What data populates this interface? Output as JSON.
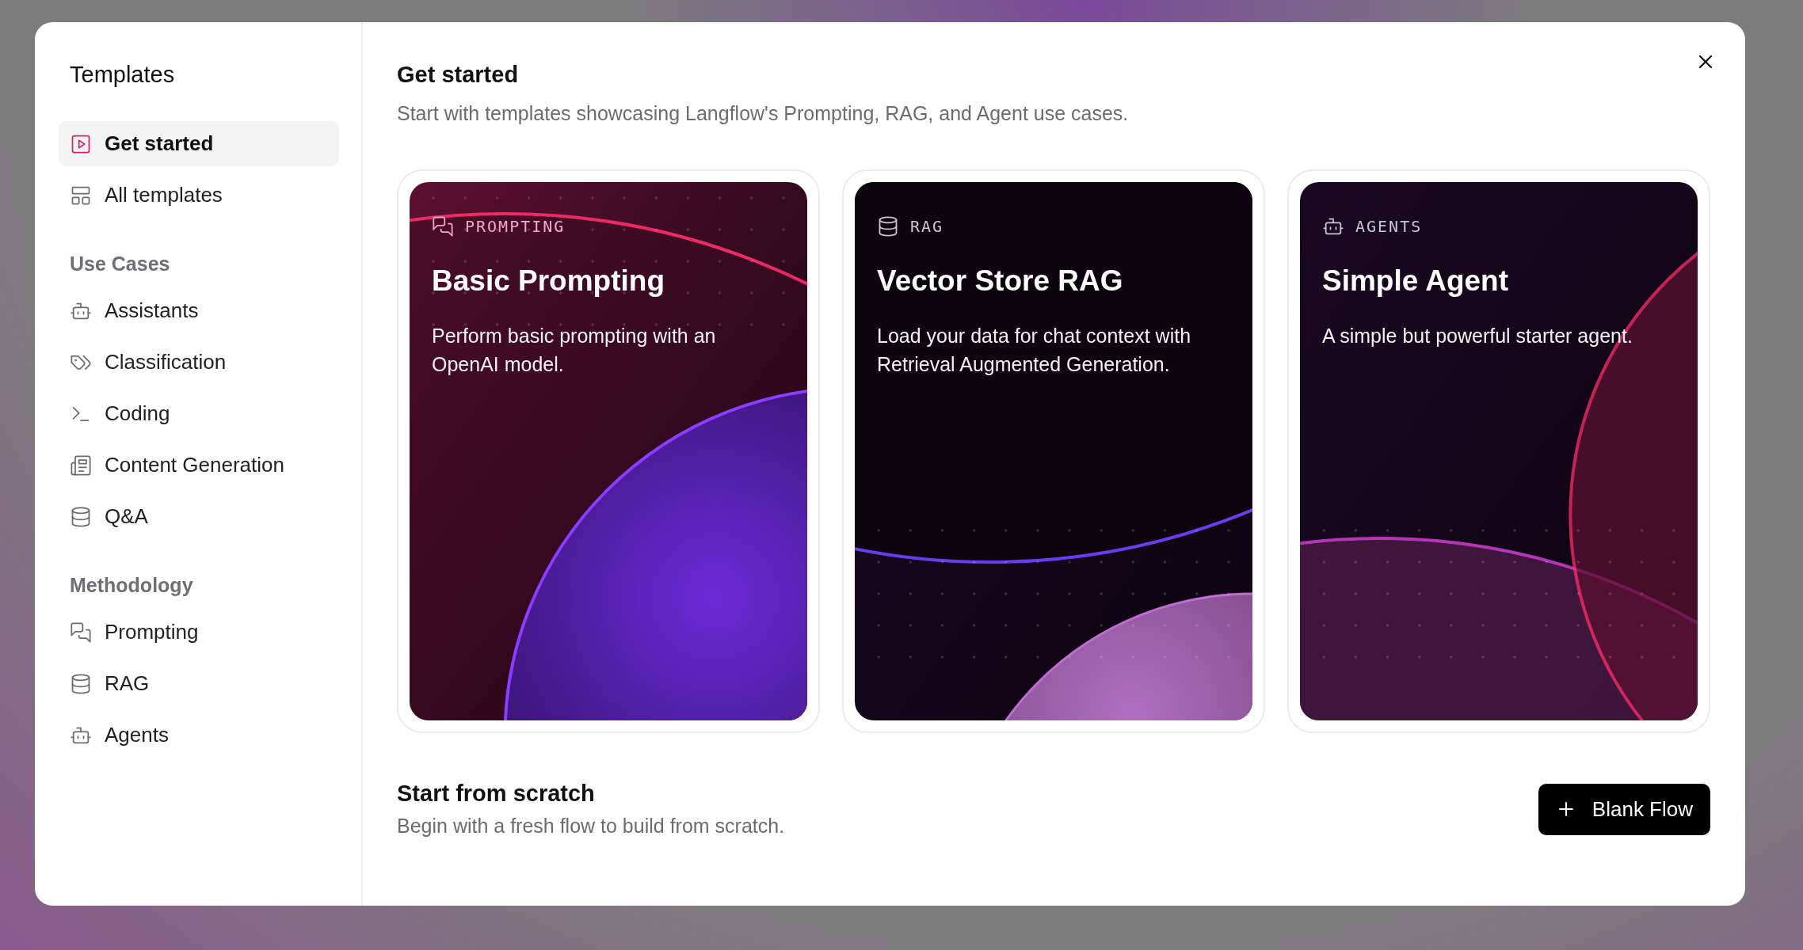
{
  "sidebar": {
    "title": "Templates",
    "items": [
      {
        "label": "Get started",
        "kind": "play",
        "selected": true
      },
      {
        "label": "All templates",
        "kind": "layout",
        "selected": false
      }
    ],
    "sections": [
      {
        "heading": "Use Cases",
        "items": [
          {
            "label": "Assistants",
            "kind": "bot",
            "selected": false
          },
          {
            "label": "Classification",
            "kind": "tags",
            "selected": false
          },
          {
            "label": "Coding",
            "kind": "terminal",
            "selected": false
          },
          {
            "label": "Content Generation",
            "kind": "newspaper",
            "selected": false
          },
          {
            "label": "Q&A",
            "kind": "database",
            "selected": false
          }
        ]
      },
      {
        "heading": "Methodology",
        "items": [
          {
            "label": "Prompting",
            "kind": "messages",
            "selected": false
          },
          {
            "label": "RAG",
            "kind": "database",
            "selected": false
          },
          {
            "label": "Agents",
            "kind": "bot",
            "selected": false
          }
        ]
      }
    ]
  },
  "main": {
    "title": "Get started",
    "subtitle": "Start with templates showcasing Langflow's Prompting, RAG, and Agent use cases.",
    "cards": [
      {
        "kind": "prompting",
        "tag": "PROMPTING",
        "title": "Basic Prompting",
        "description": "Perform basic prompting with an OpenAI model."
      },
      {
        "kind": "rag",
        "tag": "RAG",
        "title": "Vector Store RAG",
        "description": "Load your data for chat context with Retrieval Augmented Generation."
      },
      {
        "kind": "agents",
        "tag": "AGENTS",
        "title": "Simple Agent",
        "description": "A simple but powerful starter agent."
      }
    ],
    "scratch": {
      "title": "Start from scratch",
      "subtitle": "Begin with a fresh flow to build from scratch.",
      "button": "Blank Flow"
    }
  }
}
